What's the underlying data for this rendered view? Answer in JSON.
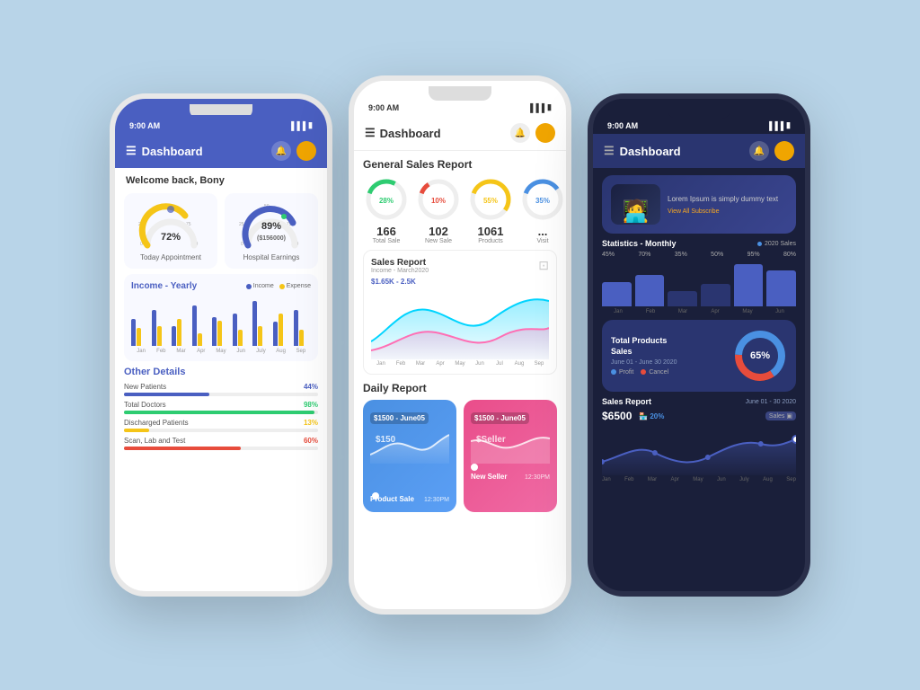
{
  "background": "#b8d4e8",
  "phone1": {
    "statusBar": {
      "time": "9:00 AM",
      "signal": "📶",
      "battery": "🔋"
    },
    "header": {
      "title": "Dashboard",
      "menuIcon": "☰",
      "bellIcon": "🔔"
    },
    "welcome": "Welcome back, Bony",
    "gauge1": {
      "label": "Today Appointment",
      "value": "72%",
      "ticks": [
        "0",
        "25",
        "50",
        "75",
        "100"
      ],
      "color": "#f5c518"
    },
    "gauge2": {
      "label": "Hospital Earnings",
      "value": "89%",
      "sub": "($156000)",
      "ticks": [
        "0",
        "25",
        "50",
        "75",
        "100"
      ],
      "color": "#4a5fc1"
    },
    "income": {
      "title": "Income - Yearly",
      "legendIncome": "Income",
      "legendExpense": "Expense",
      "months": [
        "Jan",
        "Feb",
        "Mar",
        "Apr",
        "May",
        "Jun",
        "July",
        "Aug",
        "Sep"
      ],
      "bars": [
        {
          "income": 30,
          "expense": 20
        },
        {
          "income": 45,
          "expense": 25
        },
        {
          "income": 25,
          "expense": 35
        },
        {
          "income": 50,
          "expense": 15
        },
        {
          "income": 35,
          "expense": 30
        },
        {
          "income": 40,
          "expense": 20
        },
        {
          "income": 55,
          "expense": 25
        },
        {
          "income": 30,
          "expense": 40
        },
        {
          "income": 45,
          "expense": 20
        }
      ]
    },
    "otherDetails": {
      "title": "Other Details",
      "items": [
        {
          "label": "New Patients",
          "pct": "44%",
          "value": 44,
          "color": "#4a5fc1"
        },
        {
          "label": "Total Doctors",
          "pct": "98%",
          "value": 98,
          "color": "#2ecc71"
        },
        {
          "label": "Discharged Patients",
          "pct": "13%",
          "value": 13,
          "color": "#f5c518"
        },
        {
          "label": "Scan, Lab and Test",
          "pct": "60%",
          "value": 60,
          "color": "#e74c3c"
        }
      ]
    }
  },
  "phone2": {
    "statusBar": {
      "time": "9:00 AM"
    },
    "header": {
      "title": "Dashboard"
    },
    "salesReport": {
      "title": "General Sales Report",
      "items": [
        {
          "label": "Total Sale",
          "count": "166",
          "pct": "28%",
          "color": "#2ecc71"
        },
        {
          "label": "New Sale",
          "count": "102",
          "pct": "10%",
          "color": "#e74c3c"
        },
        {
          "label": "Products",
          "count": "1061",
          "pct": "55%",
          "color": "#f5c518"
        },
        {
          "label": "Visit",
          "count": "...",
          "pct": "35%",
          "color": "#4a90e2"
        }
      ]
    },
    "salesChartTitle": "Sales Report",
    "salesChartSub": "Income - March2020",
    "salesChartLabel": "$1.65K - 2.5K",
    "dailyReport": {
      "title": "Daily Report",
      "card1": {
        "tag": "$1500 - June05",
        "price": "$150",
        "time": "12:30PM",
        "label": "Product Sale",
        "color": "blue"
      },
      "card2": {
        "tag": "$1500 - June05",
        "price": "$Seller",
        "time": "12:30PM",
        "label": "New Seller",
        "color": "pink"
      }
    }
  },
  "phone3": {
    "statusBar": {
      "time": "9:00 AM"
    },
    "header": {
      "title": "Dashboard"
    },
    "banner": {
      "text": "Lorem Ipsum is simply dummy text",
      "link": "View All Subscribe"
    },
    "monthly": {
      "title": "Statistics - Monthly",
      "legend": "2020 Sales",
      "pcts": [
        "45%",
        "70%",
        "35%",
        "50%",
        "95%",
        "80%"
      ],
      "months": [
        "Jan",
        "Feb",
        "Mar",
        "Apr",
        "May",
        "Jun"
      ],
      "bars": [
        55,
        70,
        35,
        50,
        95,
        80
      ]
    },
    "totalProducts": {
      "title": "Total Products Sales",
      "date": "June 01 - June 30 2020",
      "value": "65%",
      "legendProfit": "Profit",
      "legendCancel": "Cancel"
    },
    "salesDark": {
      "title": "Sales Report",
      "date": "June 01 - 30 2020",
      "amount": "$6500",
      "growth": "20%",
      "salesLabel": "Sales",
      "months": [
        "Jan",
        "Feb",
        "Mar",
        "Apr",
        "May",
        "Jun",
        "July",
        "Aug",
        "Sep"
      ]
    }
  }
}
